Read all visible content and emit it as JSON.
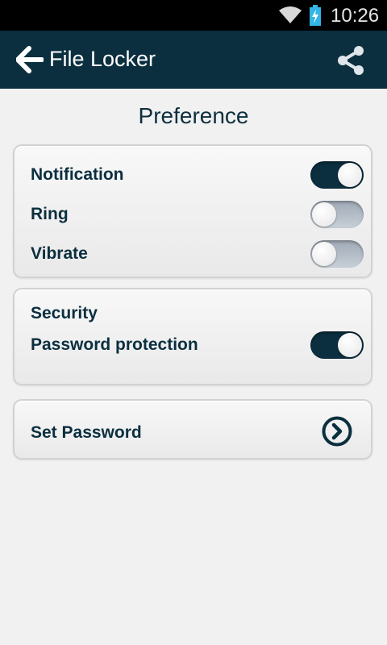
{
  "status_bar": {
    "time": "10:26",
    "icons": [
      "wifi-icon",
      "battery-charging-icon"
    ]
  },
  "app_bar": {
    "title": "File Locker",
    "back_icon": "back-arrow-icon",
    "share_icon": "share-icon"
  },
  "page": {
    "heading": "Preference"
  },
  "notifications_card": {
    "items": [
      {
        "label": "Notification",
        "on": true
      },
      {
        "label": "Ring",
        "on": false
      },
      {
        "label": "Vibrate",
        "on": false
      }
    ]
  },
  "security_card": {
    "title": "Security",
    "items": [
      {
        "label": "Password protection",
        "on": true
      }
    ]
  },
  "password_card": {
    "label": "Set Password",
    "icon": "chevron-right-circle-icon"
  },
  "colors": {
    "app_bar": "#0b2f3f",
    "toggle_on": "#0b2f3f",
    "toggle_off": "#b3bcc6",
    "background": "#f1f1f1"
  }
}
